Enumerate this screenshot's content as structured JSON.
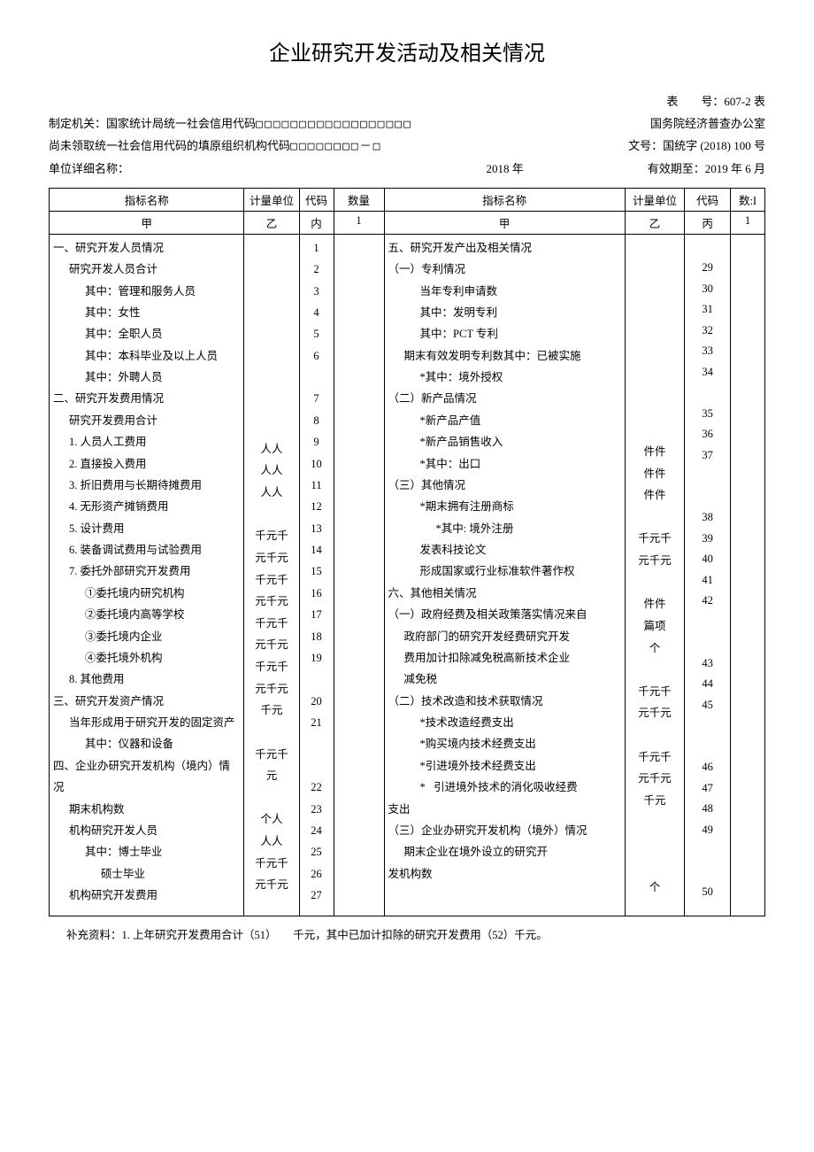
{
  "title": "企业研究开发活动及相关情况",
  "meta": {
    "form_no_label": "表　　号：",
    "form_no": "607-2 表",
    "agency_label": "制定机关：",
    "agency": "国家统计局",
    "usc_label": "统一社会信用代码",
    "usc_boxes": "□□□□□□□□□□□□□□□□□□",
    "office": "国务院经济普查办公室",
    "not_obtained": "尚未领取统一社会信用代码的填原组织机构代码",
    "org_boxes": "□□□□□□□□－□",
    "doc_label": "文号：",
    "doc_no": "国统字 (2018) 100 号",
    "unit_label": "单位详细名称：",
    "year": "2018 年",
    "valid_label": "有效期至：",
    "valid": "2019 年 6 月"
  },
  "headers": {
    "indicator": "指标名称",
    "unit": "计量单位",
    "code": "代码",
    "qty": "数量",
    "qty2": "数:I",
    "jia": "甲",
    "yi": "乙",
    "nei": "内",
    "bing": "丙",
    "one": "1"
  },
  "left": {
    "r1": "一、研究开发人员情况",
    "r2": "研究开发人员合计",
    "r3": "其中：管理和服务人员",
    "r4": "其中：女性",
    "r5": "其中：全职人员",
    "r6": "其中：本科毕业及以上人员",
    "r7": "其中：外聘人员",
    "r8": "二、研究开发费用情况",
    "r9": "研究开发费用合计",
    "r10": "1. 人员人工费用",
    "r11": "2. 直接投入费用",
    "r12": "3. 折旧费用与长期待摊费用",
    "r13": "4. 无形资产摊销费用",
    "r14": "5. 设计费用",
    "r15": "6. 装备调试费用与试验费用",
    "r16": "7. 委托外部研究开发费用",
    "r17": "①委托境内研究机构",
    "r18": "②委托境内高等学校",
    "r19": "③委托境内企业",
    "r20": "④委托境外机构",
    "r21": "8. 其他费用",
    "r22": "三、研究开发资产情况",
    "r23": "当年形成用于研究开发的固定资产",
    "r24": "其中：仪器和设备",
    "r25": "四、企业办研究开发机构（境内）情况",
    "r26": "期末机构数",
    "r27": "机构研究开发人员",
    "r28": "其中：博士毕业",
    "r29": "硕士毕业",
    "r30": "机构研究开发费用"
  },
  "left_units": "人人\n人人\n人人\n\n千元千\n元千元\n千元千\n元千元\n千元千\n元千元\n千元千\n元千元\n千元\n\n千元千\n元\n\n个人\n人人\n千元千\n元千元",
  "left_codes": "1\n2\n3\n4\n5\n6\n\n7\n8\n9\n10\n11\n12\n13\n14\n15\n16\n17\n18\n19\n\n20\n21\n\n\n22\n23\n24\n25\n26\n27",
  "right": {
    "r1": "五、研究开发产出及相关情况",
    "r2": "（一）专利情况",
    "r3": "当年专利申请数",
    "r4": "其中：发明专利",
    "r5": "其中：PCT 专利",
    "r6": "期末有效发明专利数其中：已被实施",
    "r7": "*其中：境外授权",
    "r8": "（二）新产品情况",
    "r9": "*新产品产值",
    "r10": "*新产品销售收入",
    "r11": "*其中：出口",
    "r12": "（三）其他情况",
    "r13": "*期末拥有注册商标",
    "r14": "*其中: 境外注册",
    "r15": "发表科技论文",
    "r16": "形成国家或行业标准软件著作权",
    "r17": "六、其他相关情况",
    "r18": "（一）政府经费及相关政策落实情况来自",
    "r19": "政府部门的研究开发经费研究开发",
    "r20": "费用加计扣除减免税高新技术企业",
    "r21": "减免税",
    "r22": "（二）技术改造和技术获取情况",
    "r23": "*技术改造经费支出",
    "r24": "*购买境内技术经费支出",
    "r25": "*引进境外技术经费支出",
    "r26a": "*",
    "r26b": "引进境外技术的消化吸收经费",
    "r27": "支出",
    "r28": "（三）企业办研究开发机构（境外）情况",
    "r29": "期末企业在境外设立的研究开",
    "r30": "发机构数"
  },
  "right_units": "\n\n\n\n\n件件\n件件\n件件\n\n千元千\n元千元\n\n件件\n篇项\n个\n\n千元千\n元千元\n\n千元千\n元千元\n千元\n\n\n\n个",
  "right_codes": "\n29\n30\n31\n32\n33\n34\n\n35\n36\n37\n\n\n38\n39\n40\n41\n42\n\n\n43\n44\n45\n\n\n46\n47\n48\n49\n\n\n50",
  "footnote": "补充资料：1. 上年研究开发费用合计（51）　　千元，其中已加计扣除的研究开发费用（52）千元。"
}
